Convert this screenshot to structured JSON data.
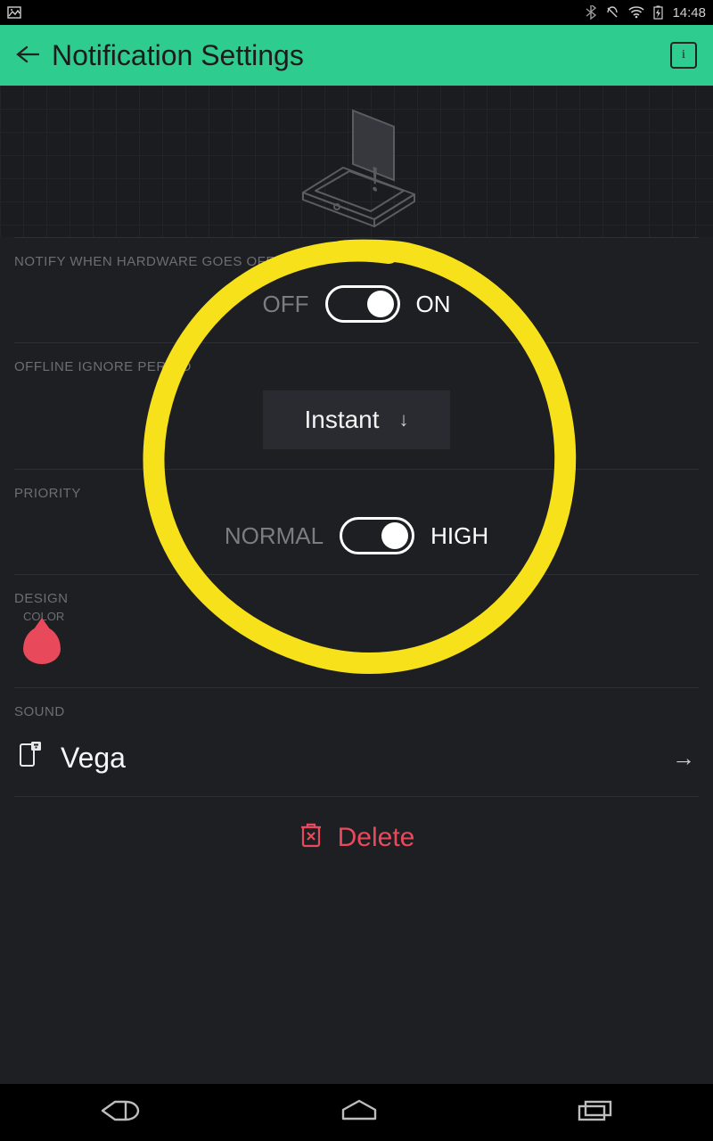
{
  "statusbar": {
    "time": "14:48"
  },
  "header": {
    "title": "Notification Settings",
    "info_glyph": "i"
  },
  "sections": {
    "notify_offline": {
      "label": "NOTIFY WHEN HARDWARE GOES OFFLINE",
      "off": "OFF",
      "on": "ON"
    },
    "ignore_period": {
      "label": "OFFLINE IGNORE PERIOD",
      "value": "Instant"
    },
    "priority": {
      "label": "PRIORITY",
      "normal": "NORMAL",
      "high": "HIGH"
    },
    "design": {
      "label": "DESIGN",
      "color_label": "COLOR",
      "color_hex": "#e94a5b"
    },
    "sound": {
      "label": "SOUND",
      "value": "Vega"
    }
  },
  "delete": {
    "label": "Delete"
  }
}
